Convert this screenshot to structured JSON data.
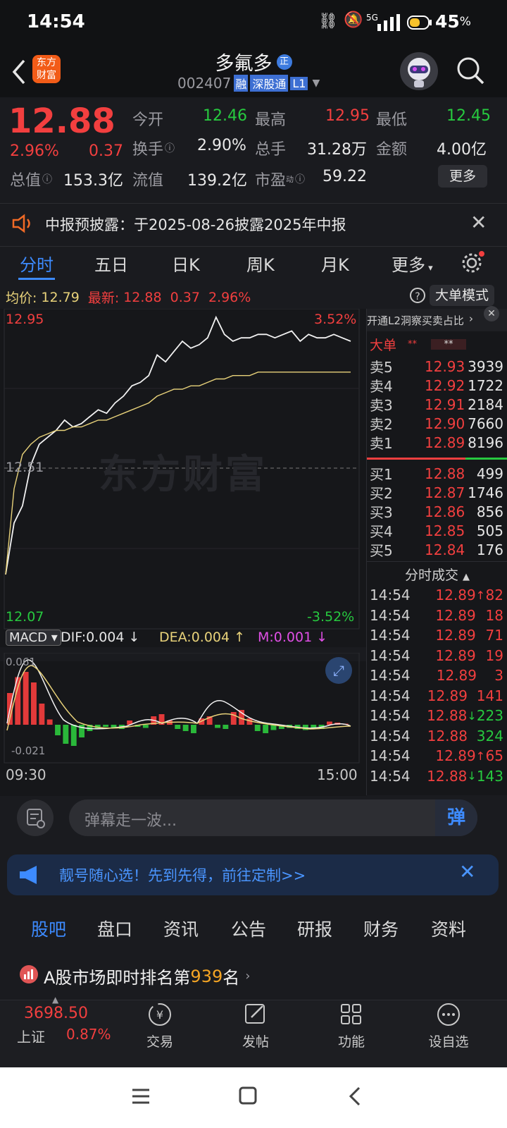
{
  "status_bar": {
    "time": "14:54",
    "battery": "45",
    "battery_unit": "%",
    "network": "5G"
  },
  "header": {
    "title": "多氟多",
    "title_badge": "正",
    "code": "002407",
    "tags": [
      "融",
      "深股通",
      "L1"
    ],
    "logo_text_1": "东方",
    "logo_text_2": "财富"
  },
  "quote": {
    "price": "12.88",
    "change_pct": "2.96%",
    "change": "0.37",
    "open_label": "今开",
    "open": "12.46",
    "high_label": "最高",
    "high": "12.95",
    "low_label": "最低",
    "low": "12.45",
    "turnover_label": "换手",
    "turnover": "2.90%",
    "volume_label": "总手",
    "volume": "31.28万",
    "amount_label": "金额",
    "amount": "4.00亿",
    "mktcap_label": "总值",
    "mktcap": "153.3亿",
    "float_label": "流值",
    "float": "139.2亿",
    "pe_label": "市盈",
    "pe_sup": "动",
    "pe": "59.22",
    "more_button": "更多"
  },
  "notice": {
    "text": "中报预披露：于2025-08-26披露2025年中报"
  },
  "tabs": {
    "items": [
      "分时",
      "五日",
      "日K",
      "周K",
      "月K",
      "更多"
    ],
    "active": 0
  },
  "avg_line": {
    "avg_label": "均价:",
    "avg": "12.79",
    "latest_label": "最新:",
    "latest": "12.88",
    "change": "0.37",
    "change_pct": "2.96%",
    "mode_button": "大单模式"
  },
  "chart": {
    "top_price": "12.95",
    "top_pct": "3.52%",
    "mid_price": "12.51",
    "bottom_price": "12.07",
    "bottom_pct": "-3.52%",
    "watermark": "东方财富",
    "time_start": "09:30",
    "time_end": "15:00"
  },
  "chart_data": {
    "type": "line",
    "title": "",
    "ylim": [
      12.07,
      12.95
    ],
    "series": [
      {
        "name": "",
        "values": [
          12.2,
          12.35,
          12.4,
          12.52,
          12.58,
          12.6,
          12.62,
          12.65,
          12.63,
          12.64,
          12.66,
          12.68,
          12.67,
          12.7,
          12.72,
          12.75,
          12.76,
          12.78,
          12.84,
          12.82,
          12.85,
          12.88,
          12.86,
          12.87,
          12.89,
          12.95,
          12.9,
          12.88,
          12.89,
          12.89,
          12.9,
          12.9,
          12.89,
          12.9,
          12.91,
          12.88,
          12.9,
          12.89,
          12.89,
          12.9,
          12.89,
          12.88
        ]
      },
      {
        "name": "",
        "values": [
          12.2,
          12.45,
          12.55,
          12.58,
          12.6,
          12.61,
          12.62,
          12.62,
          12.63,
          12.63,
          12.64,
          12.65,
          12.65,
          12.66,
          12.67,
          12.68,
          12.69,
          12.7,
          12.72,
          12.73,
          12.74,
          12.74,
          12.75,
          12.75,
          12.76,
          12.77,
          12.77,
          12.78,
          12.78,
          12.78,
          12.79,
          12.79,
          12.79,
          12.79,
          12.79,
          12.79,
          12.79,
          12.79,
          12.79,
          12.79,
          12.79,
          12.79
        ]
      }
    ]
  },
  "macd": {
    "label": "MACD",
    "dif_label": "DIF:",
    "dif": "0.004",
    "dea_label": "DEA:",
    "dea": "0.004",
    "m_label": "M:",
    "m": "0.001",
    "top": "0.061",
    "bottom": "-0.021",
    "bars": [
      0.03,
      0.045,
      0.05,
      0.04,
      0.02,
      0.005,
      -0.01,
      -0.018,
      -0.02,
      -0.012,
      -0.006,
      -0.004,
      -0.002,
      -0.003,
      -0.004,
      0.004,
      -0.002,
      -0.003,
      0.008,
      0.01,
      0.004,
      -0.004,
      -0.006,
      -0.008,
      0.006,
      0.008,
      -0.003,
      -0.004,
      0.012,
      0.014,
      0.006,
      -0.006,
      -0.008,
      -0.005,
      -0.004,
      -0.003,
      -0.004,
      -0.005,
      -0.003,
      -0.004,
      0.003,
      0.002,
      0.001
    ]
  },
  "order_book": {
    "banner": "开通L2洞察买卖占比",
    "big_label": "大单",
    "big_v1": "**",
    "big_v2": "**",
    "asks": [
      {
        "label": "卖5",
        "price": "12.93",
        "vol": "3939"
      },
      {
        "label": "卖4",
        "price": "12.92",
        "vol": "1722"
      },
      {
        "label": "卖3",
        "price": "12.91",
        "vol": "2184"
      },
      {
        "label": "卖2",
        "price": "12.90",
        "vol": "7660"
      },
      {
        "label": "卖1",
        "price": "12.89",
        "vol": "8196"
      }
    ],
    "bids": [
      {
        "label": "买1",
        "price": "12.88",
        "vol": "499"
      },
      {
        "label": "买2",
        "price": "12.87",
        "vol": "1746"
      },
      {
        "label": "买3",
        "price": "12.86",
        "vol": "856"
      },
      {
        "label": "买4",
        "price": "12.85",
        "vol": "505"
      },
      {
        "label": "买5",
        "price": "12.84",
        "vol": "176"
      }
    ],
    "ticks_title": "分时成交",
    "ticks": [
      {
        "time": "14:54",
        "price": "12.89",
        "dir": "↑",
        "vol": "82",
        "color": "#f23f3f"
      },
      {
        "time": "14:54",
        "price": "12.89",
        "dir": "",
        "vol": "18",
        "color": "#f23f3f"
      },
      {
        "time": "14:54",
        "price": "12.89",
        "dir": "",
        "vol": "71",
        "color": "#f23f3f"
      },
      {
        "time": "14:54",
        "price": "12.89",
        "dir": "",
        "vol": "19",
        "color": "#f23f3f"
      },
      {
        "time": "14:54",
        "price": "12.89",
        "dir": "",
        "vol": "3",
        "color": "#f23f3f"
      },
      {
        "time": "14:54",
        "price": "12.89",
        "dir": "",
        "vol": "141",
        "color": "#f23f3f"
      },
      {
        "time": "14:54",
        "price": "12.88",
        "dir": "↓",
        "vol": "223",
        "color": "#27c93f"
      },
      {
        "time": "14:54",
        "price": "12.88",
        "dir": "",
        "vol": "324",
        "color": "#27c93f"
      },
      {
        "time": "14:54",
        "price": "12.89",
        "dir": "↑",
        "vol": "65",
        "color": "#f23f3f"
      },
      {
        "time": "14:54",
        "price": "12.88",
        "dir": "↓",
        "vol": "143",
        "color": "#27c93f"
      }
    ]
  },
  "danmu": {
    "placeholder": "弹幕走一波...",
    "send": "弹"
  },
  "promo": {
    "text": "靓号随心选！先到先得，前往定制>>"
  },
  "bar_tabs": {
    "items": [
      "股吧",
      "盘口",
      "资讯",
      "公告",
      "研报",
      "财务",
      "资料"
    ],
    "active": 0
  },
  "rank": {
    "prefix": "A股市场即时排名第",
    "rank": "939",
    "suffix": "名"
  },
  "bottom_nav": {
    "index_value": "3698.50",
    "index_name": "上证",
    "index_pct": "0.87%",
    "items": [
      "交易",
      "发帖",
      "功能",
      "设自选"
    ]
  },
  "colors": {
    "up": "#f23f3f",
    "down": "#27c93f",
    "accent": "#3d8bff",
    "avg": "#e8d27a"
  }
}
